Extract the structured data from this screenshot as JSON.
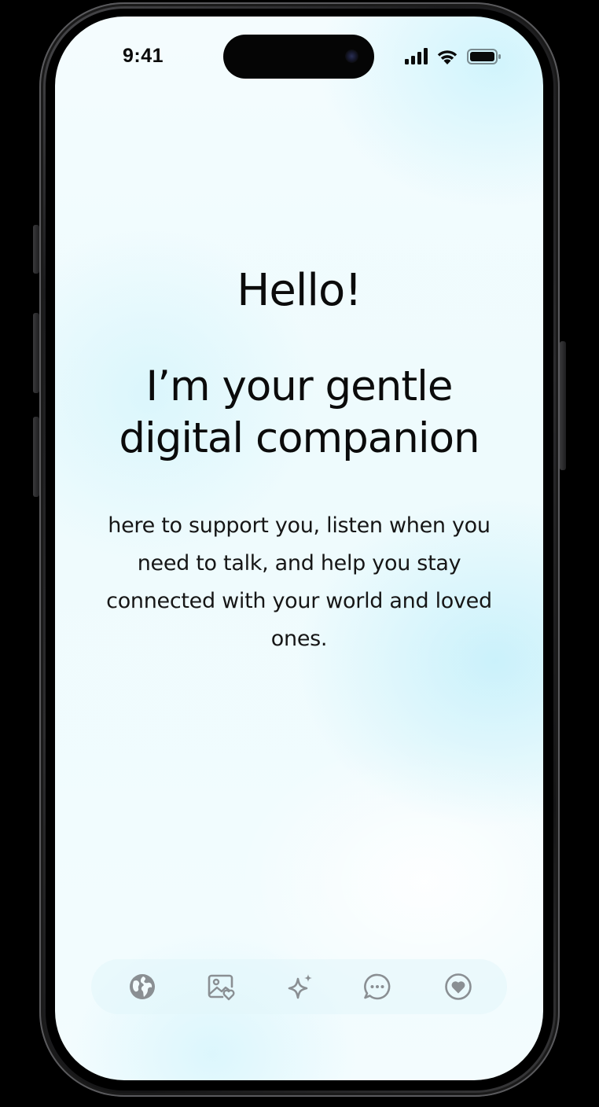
{
  "status_bar": {
    "time": "9:41",
    "icons": [
      "cellular-signal-icon",
      "wifi-icon",
      "battery-icon"
    ]
  },
  "content": {
    "greeting": "Hello!",
    "headline_lines": [
      "I’m your gentle",
      "digital companion"
    ],
    "description": "here to support you, listen when you need to talk, and help you stay connected with your world and loved ones."
  },
  "bottom_nav": {
    "items": [
      {
        "icon": "globe-icon"
      },
      {
        "icon": "photo-heart-icon"
      },
      {
        "icon": "sparkle-icon"
      },
      {
        "icon": "chat-bubble-icon"
      },
      {
        "icon": "heart-circle-icon"
      }
    ]
  },
  "colors": {
    "screen_background": "#eefbfd",
    "text": "#0b0b0b",
    "nav_icon": "#8a8f93",
    "frame": "#2c2c2e"
  }
}
